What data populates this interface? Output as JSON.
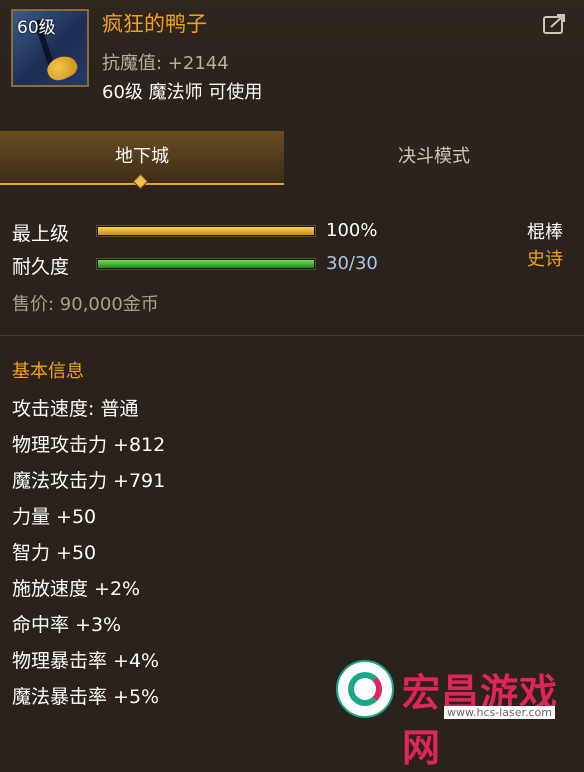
{
  "item": {
    "level_badge": "60级",
    "name": "疯狂的鸭子",
    "magic_resistance": "抗魔值: +2144",
    "requirement": "60级 魔法师 可使用"
  },
  "tabs": [
    {
      "label": "地下城",
      "active": true
    },
    {
      "label": "决斗模式",
      "active": false
    }
  ],
  "stats": {
    "upgrade": {
      "label": "最上级",
      "value": "100%",
      "fill": 1.0
    },
    "durability": {
      "label": "耐久度",
      "value": "30/30",
      "fill": 1.0
    }
  },
  "weapon_type": "棍棒",
  "rarity": "史诗",
  "price": "售价: 90,000金币",
  "basic_info": {
    "title": "基本信息",
    "lines": [
      "攻击速度: 普通",
      "物理攻击力 +812",
      "魔法攻击力 +791",
      "力量 +50",
      "智力 +50",
      "施放速度 +2%",
      "命中率 +3%",
      "物理暴击率 +4%",
      "魔法暴击率 +5%"
    ]
  },
  "watermark": {
    "text": "宏昌游戏网",
    "url": "www.hcs-laser.com"
  },
  "colors": {
    "background": "#2a221b",
    "accent_gold": "#f0a31a",
    "bar_gold": "#e0b030",
    "bar_green": "#3fb52a",
    "value_blue": "#a9c6e8"
  },
  "icons": {
    "share": "share-export-icon"
  }
}
